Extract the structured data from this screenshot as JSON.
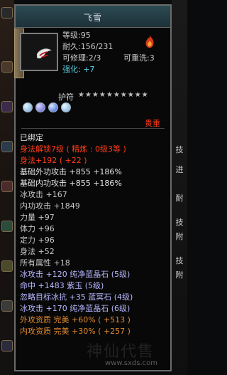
{
  "window": {
    "title": "飞雪"
  },
  "item": {
    "level": "等级:95",
    "durability": "耐久:156/231",
    "repairable": "可修理:2/3",
    "rewash": "可重洗:3",
    "enhance_label": "强化:",
    "enhance_value": "+7"
  },
  "charm": {
    "label": "护符",
    "stars": "★★★★★★★★★★"
  },
  "rarity": "贵重",
  "attributes": {
    "bound": "已绑定",
    "body_unlock": "身法解锁7级 ( 精炼 : 0级3等 )",
    "body_bonus": "身法+192 ( +22 )",
    "base_ext_attack": "基础外功攻击 +855 +186%",
    "base_int_attack": "基础内功攻击 +855 +186%",
    "ice_attack": "冰攻击 +167",
    "int_attack": "内功攻击 +1849",
    "strength": "力量 +97",
    "vitality": "体力 +96",
    "focus": "定力 +96",
    "agility": "身法 +52",
    "all_attrs": "所有属性 +18",
    "ice_attack_gem": "冰攻击 +120 纯净蓝晶石 (5级)",
    "hit_gem": "命中 +1483 紫玉 (5级)",
    "ignore_ice": "忽略目标冰抗 +35 蓝冥石 (4级)",
    "ice_attack_gem2": "冰攻击 +170 纯净蓝晶石 (6级)",
    "ext_quality": "外攻资质  完美 +60% ( +513 )",
    "int_quality": "内攻资质  完美 +30% ( +257 )"
  },
  "right_text": [
    "技",
    "进",
    "耐",
    "技",
    "附",
    "技",
    "附"
  ],
  "watermark": "www.sxds.com",
  "watermark_brand": "神仙代售",
  "colors": {
    "panel_border": "#6b6b6b",
    "title_bg": "#2c4a53",
    "cyan": "#59d1e8",
    "red": "#ff3b1a",
    "orange": "#e08a2d",
    "lavender": "#b8b7ff"
  }
}
